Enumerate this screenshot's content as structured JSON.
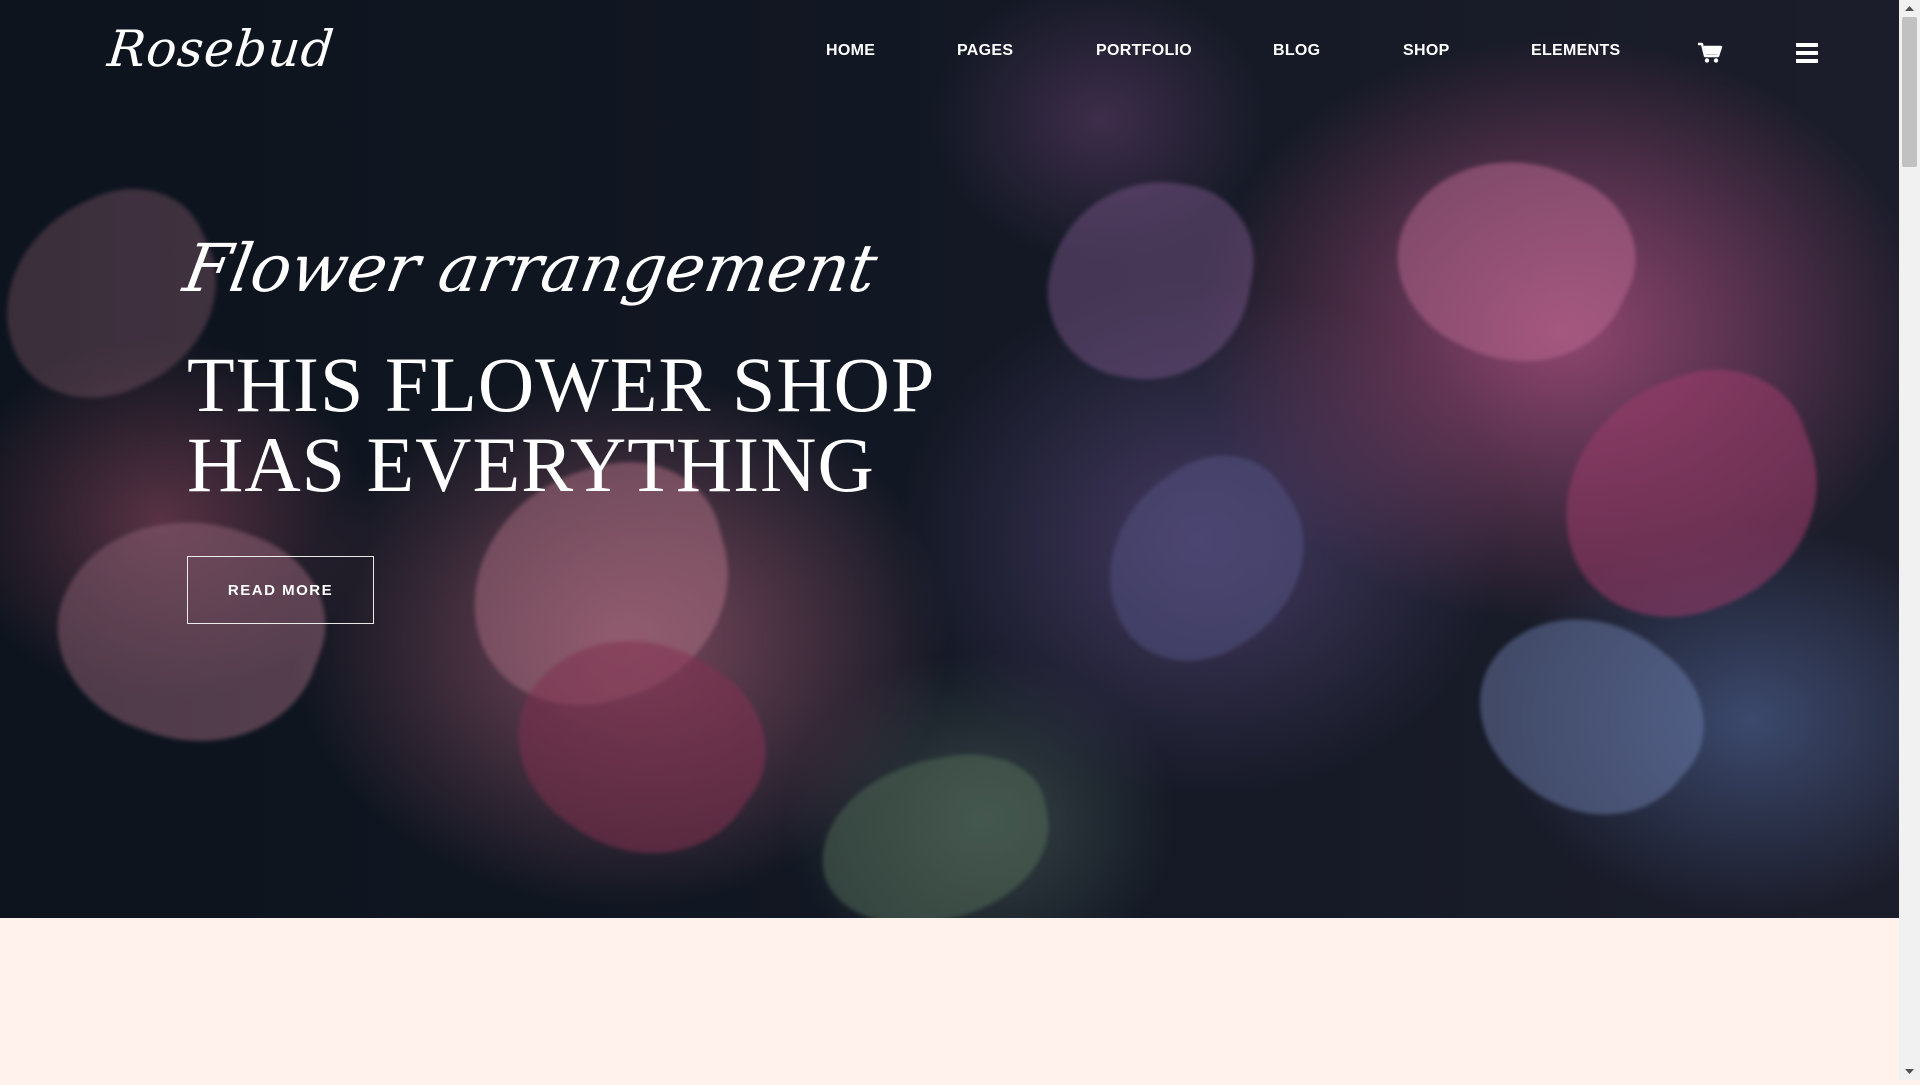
{
  "site": {
    "logo": "Rosebud"
  },
  "nav": {
    "items": [
      {
        "label": "HOME"
      },
      {
        "label": "PAGES"
      },
      {
        "label": "PORTFOLIO"
      },
      {
        "label": "BLOG"
      },
      {
        "label": "SHOP"
      },
      {
        "label": "ELEMENTS"
      }
    ],
    "cart_icon": "cart-icon",
    "menu_icon": "hamburger-menu-icon"
  },
  "hero": {
    "script_title": "Flower arrangement",
    "headline_line1": "THIS FLOWER SHOP",
    "headline_line2": "HAS EVERYTHING",
    "button_label": "READ MORE"
  },
  "colors": {
    "hero_dark": "#141a26",
    "page_background": "#fff1ec",
    "text": "#ffffff"
  }
}
